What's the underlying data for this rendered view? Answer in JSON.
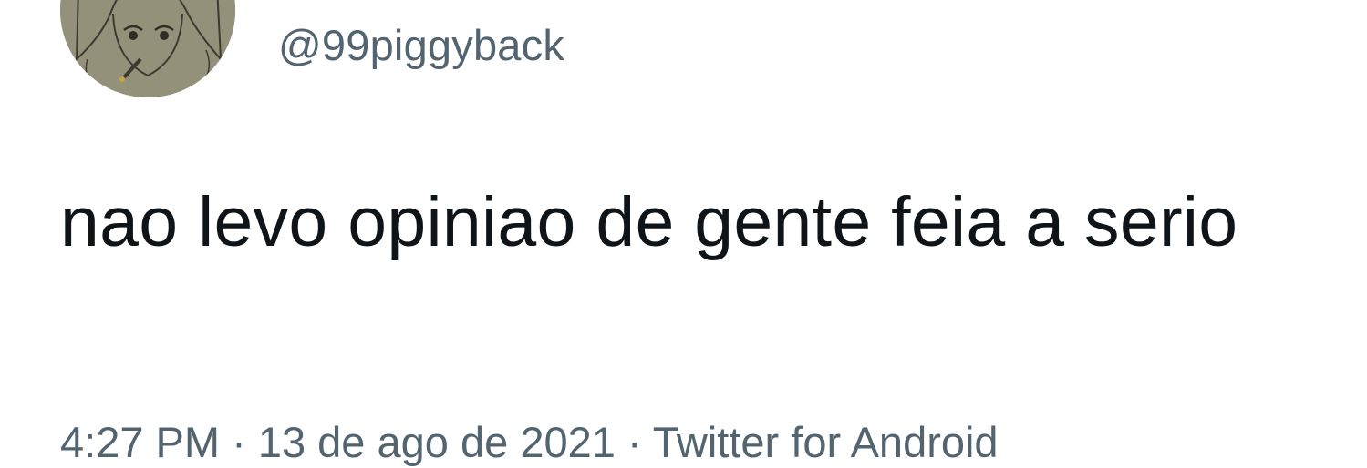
{
  "tweet": {
    "handle": "@99piggyback",
    "text": "nao levo opiniao de gente feia a serio",
    "meta": {
      "time": "4:27 PM",
      "separator": " · ",
      "date": "13 de ago de 2021",
      "source": "Twitter for Android"
    }
  },
  "colors": {
    "text": "#0f1419",
    "secondary": "#536471",
    "background": "#ffffff"
  }
}
